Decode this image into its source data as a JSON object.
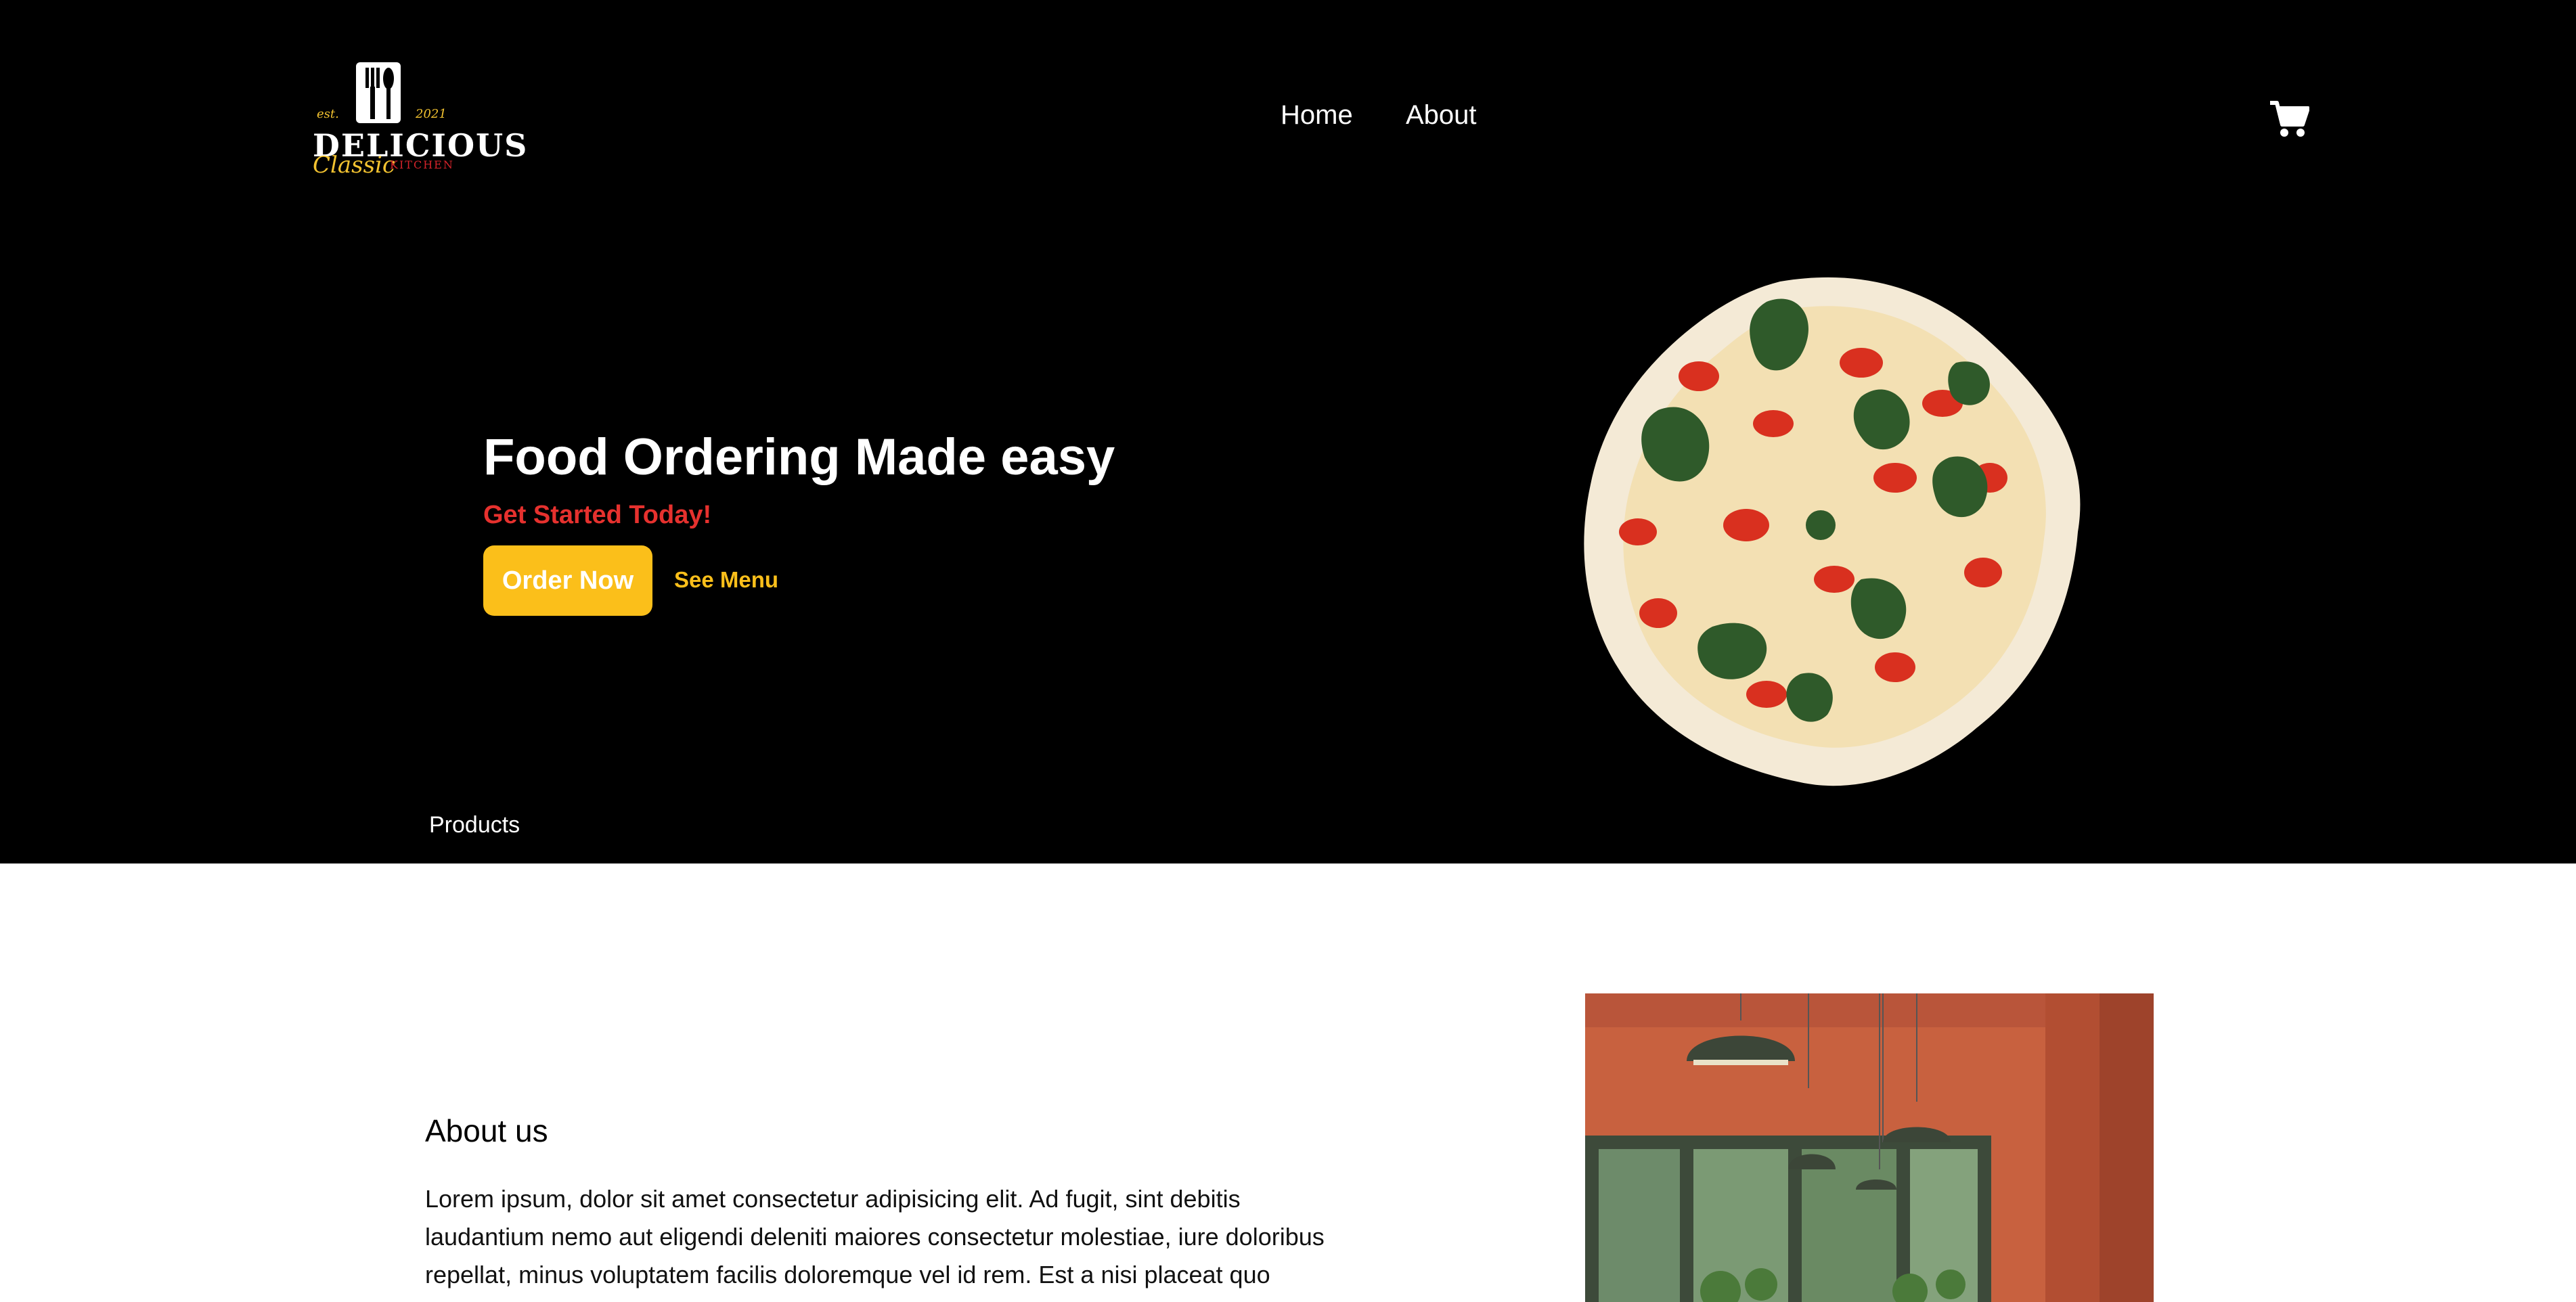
{
  "logo": {
    "brand": "DELICIOUS",
    "est": "est.",
    "year": "2021",
    "classic": "Classic",
    "kitchen": "KITCHEN"
  },
  "nav": {
    "home": "Home",
    "about": "About",
    "cart_icon": "shopping-cart-icon"
  },
  "hero": {
    "title": "Food Ordering Made easy",
    "subtitle": "Get Started Today!",
    "order_button": "Order Now",
    "menu_link": "See Menu",
    "image_icon": "pizza-image"
  },
  "products_label": "Products",
  "about": {
    "title": "About us",
    "text": "Lorem ipsum, dolor sit amet consectetur adipisicing elit. Ad fugit, sint debitis laudantium nemo aut eligendi deleniti maiores consectetur molestiae, iure doloribus repellat, minus voluptatem facilis doloremque vel id rem. Est a nisi placeat quo",
    "image_icon": "restaurant-interior-image"
  },
  "colors": {
    "hero_bg": "#000000",
    "accent_yellow": "#fbbf1a",
    "accent_red": "#e6312e"
  }
}
